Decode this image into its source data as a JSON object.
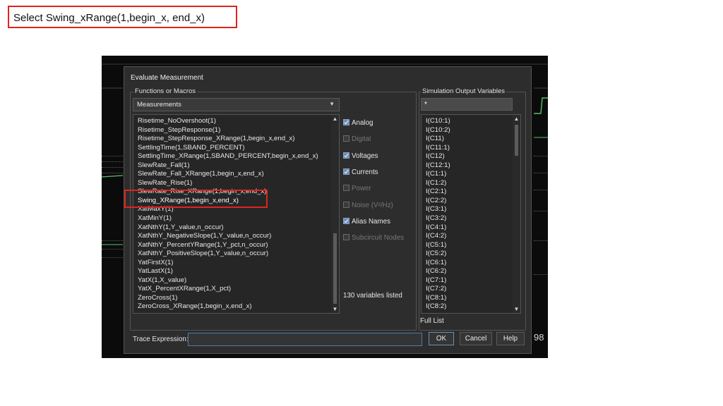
{
  "caption": "Select Swing_xRange(1,begin_x, end_x)",
  "background": {
    "partial_text": "98"
  },
  "dialog": {
    "title": "Evaluate Measurement",
    "functions_group_label": "Functions or Macros",
    "functions_combo_value": "Measurements",
    "functions_list": [
      "Risetime_NoOvershoot(1)",
      "Risetime_StepResponse(1)",
      "Risetime_StepResponse_XRange(1,begin_x,end_x)",
      "SettlingTime(1,SBAND_PERCENT)",
      "SettlingTime_XRange(1,SBAND_PERCENT,begin_x,end_x)",
      "SlewRate_Fall(1)",
      "SlewRate_Fall_XRange(1,begin_x,end_x)",
      "SlewRate_Rise(1)",
      "SlewRate_Rise_XRange(1,begin_x,end_x)",
      "Swing_XRange(1,begin_x,end_x)",
      "XatMaxY(1)",
      "XatMinY(1)",
      "XatNthY(1,Y_value,n_occur)",
      "XatNthY_NegativeSlope(1,Y_value,n_occur)",
      "XatNthY_PercentYRange(1,Y_pct,n_occur)",
      "XatNthY_PositiveSlope(1,Y_value,n_occur)",
      "YatFirstX(1)",
      "YatLastX(1)",
      "YatX(1,X_value)",
      "YatX_PercentXRange(1,X_pct)",
      "ZeroCross(1)",
      "ZeroCross_XRange(1,begin_x,end_x)"
    ],
    "selected_function": "Swing_XRange(1,begin_x,end_x)",
    "options": {
      "analog": "Analog",
      "digital": "Digital",
      "voltages": "Voltages",
      "currents": "Currents",
      "power": "Power",
      "noise": "Noise (V²/Hz)",
      "alias_names": "Alias Names",
      "subcircuit_nodes": "Subcircuit Nodes"
    },
    "variables_count": "130 variables listed",
    "sim_group_label": "Simulation Output Variables",
    "sim_filter_value": "*",
    "sim_vars": [
      "I(C10:1)",
      "I(C10:2)",
      "I(C11)",
      "I(C11:1)",
      "I(C12)",
      "I(C12:1)",
      "I(C1:1)",
      "I(C1:2)",
      "I(C2:1)",
      "I(C2:2)",
      "I(C3:1)",
      "I(C3:2)",
      "I(C4:1)",
      "I(C4:2)",
      "I(C5:1)",
      "I(C5:2)",
      "I(C6:1)",
      "I(C6:2)",
      "I(C7:1)",
      "I(C7:2)",
      "I(C8:1)",
      "I(C8:2)"
    ],
    "full_list_label": "Full List",
    "trace_expression_label": "Trace Expression:",
    "trace_expression_value": "",
    "buttons": {
      "ok": "OK",
      "cancel": "Cancel",
      "help": "Help"
    }
  }
}
